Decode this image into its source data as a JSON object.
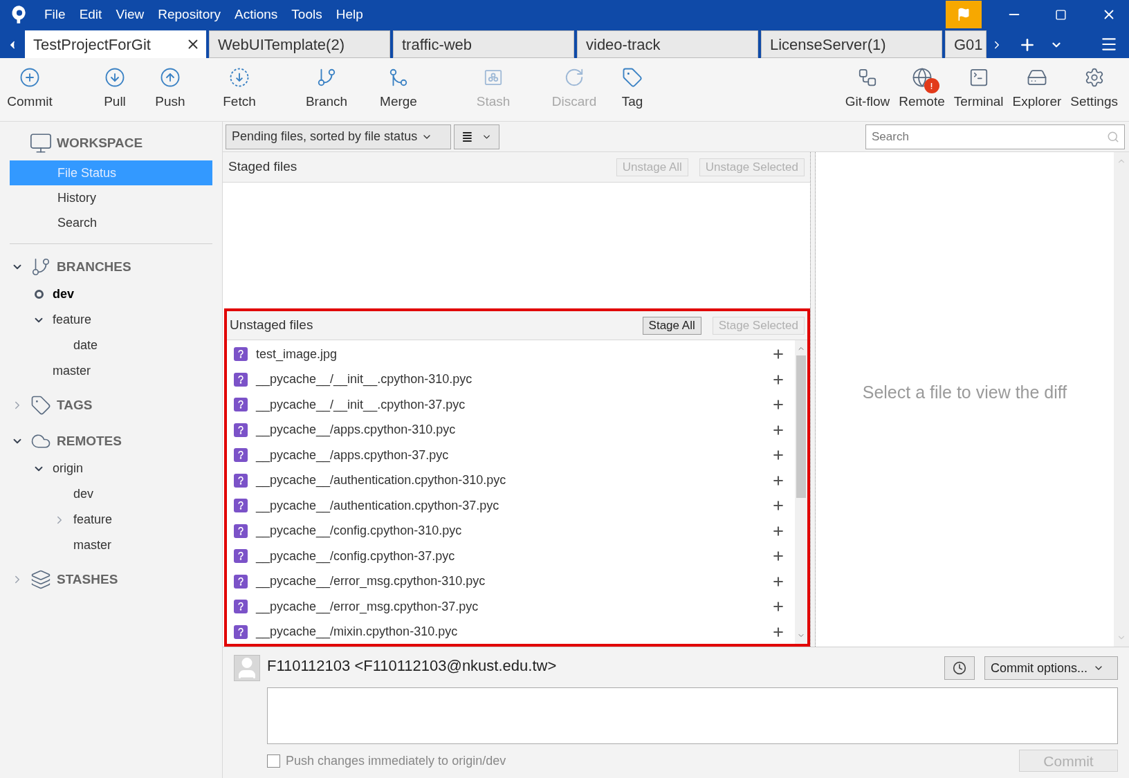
{
  "menu": [
    "File",
    "Edit",
    "View",
    "Repository",
    "Actions",
    "Tools",
    "Help"
  ],
  "tabs": [
    {
      "label": "TestProjectForGit",
      "selected": true
    },
    {
      "label": "WebUITemplate(2)",
      "selected": false
    },
    {
      "label": "traffic-web",
      "selected": false
    },
    {
      "label": "video-track",
      "selected": false
    },
    {
      "label": "LicenseServer(1)",
      "selected": false
    },
    {
      "label": "G01",
      "selected": false
    }
  ],
  "toolbar_left": [
    {
      "label": "Commit",
      "disabled": false
    },
    {
      "label": "Pull",
      "disabled": false
    },
    {
      "label": "Push",
      "disabled": false
    },
    {
      "label": "Fetch",
      "disabled": false
    },
    {
      "label": "Branch",
      "disabled": false
    },
    {
      "label": "Merge",
      "disabled": false
    },
    {
      "label": "Stash",
      "disabled": true
    },
    {
      "label": "Discard",
      "disabled": true
    },
    {
      "label": "Tag",
      "disabled": false
    }
  ],
  "toolbar_right": [
    {
      "label": "Git-flow"
    },
    {
      "label": "Remote",
      "alert": true
    },
    {
      "label": "Terminal"
    },
    {
      "label": "Explorer"
    },
    {
      "label": "Settings"
    }
  ],
  "sidebar": {
    "workspace": {
      "title": "WORKSPACE",
      "items": [
        {
          "label": "File Status",
          "selected": true
        },
        {
          "label": "History",
          "selected": false
        },
        {
          "label": "Search",
          "selected": false
        }
      ]
    },
    "sections": [
      {
        "title": "BRANCHES",
        "expanded": true,
        "children": [
          {
            "label": "dev",
            "current": true
          },
          {
            "label": "feature",
            "current": false,
            "expanded": true,
            "children": [
              {
                "label": "date",
                "current": false
              }
            ]
          },
          {
            "label": "master",
            "current": false
          }
        ]
      },
      {
        "title": "TAGS",
        "expanded": false
      },
      {
        "title": "REMOTES",
        "expanded": true,
        "children": [
          {
            "label": "origin",
            "expanded": true,
            "children": [
              {
                "label": "dev"
              },
              {
                "label": "feature",
                "expanded": false
              },
              {
                "label": "master"
              }
            ]
          }
        ]
      },
      {
        "title": "STASHES",
        "expanded": false
      }
    ]
  },
  "filter": {
    "value": "Pending files, sorted by file status",
    "view_icon": "≣"
  },
  "search": {
    "placeholder": "Search"
  },
  "staged": {
    "title": "Staged files",
    "buttons": [
      {
        "label": "Unstage All",
        "disabled": true
      },
      {
        "label": "Unstage Selected",
        "disabled": true
      }
    ]
  },
  "unstaged": {
    "title": "Unstaged files",
    "highlighted": true,
    "buttons": [
      {
        "label": "Stage All",
        "disabled": false
      },
      {
        "label": "Stage Selected",
        "disabled": true
      }
    ],
    "files": [
      {
        "name": "test_image.jpg",
        "kind": "untracked"
      },
      {
        "name": "__pycache__/__init__.cpython-310.pyc",
        "kind": "untracked"
      },
      {
        "name": "__pycache__/__init__.cpython-37.pyc",
        "kind": "untracked"
      },
      {
        "name": "__pycache__/apps.cpython-310.pyc",
        "kind": "untracked"
      },
      {
        "name": "__pycache__/apps.cpython-37.pyc",
        "kind": "untracked"
      },
      {
        "name": "__pycache__/authentication.cpython-310.pyc",
        "kind": "untracked"
      },
      {
        "name": "__pycache__/authentication.cpython-37.pyc",
        "kind": "untracked"
      },
      {
        "name": "__pycache__/config.cpython-310.pyc",
        "kind": "untracked"
      },
      {
        "name": "__pycache__/config.cpython-37.pyc",
        "kind": "untracked"
      },
      {
        "name": "__pycache__/error_msg.cpython-310.pyc",
        "kind": "untracked"
      },
      {
        "name": "__pycache__/error_msg.cpython-37.pyc",
        "kind": "untracked"
      },
      {
        "name": "__pycache__/mixin.cpython-310.pyc",
        "kind": "untracked"
      }
    ]
  },
  "diff": {
    "message": "Select a file to view the diff"
  },
  "commit": {
    "author": "F110112103 <F110112103@nkust.edu.tw>",
    "options": "Commit options...",
    "push_label": "Push changes immediately to origin/dev",
    "push_checked": false,
    "button": {
      "label": "Commit",
      "disabled": true
    }
  }
}
